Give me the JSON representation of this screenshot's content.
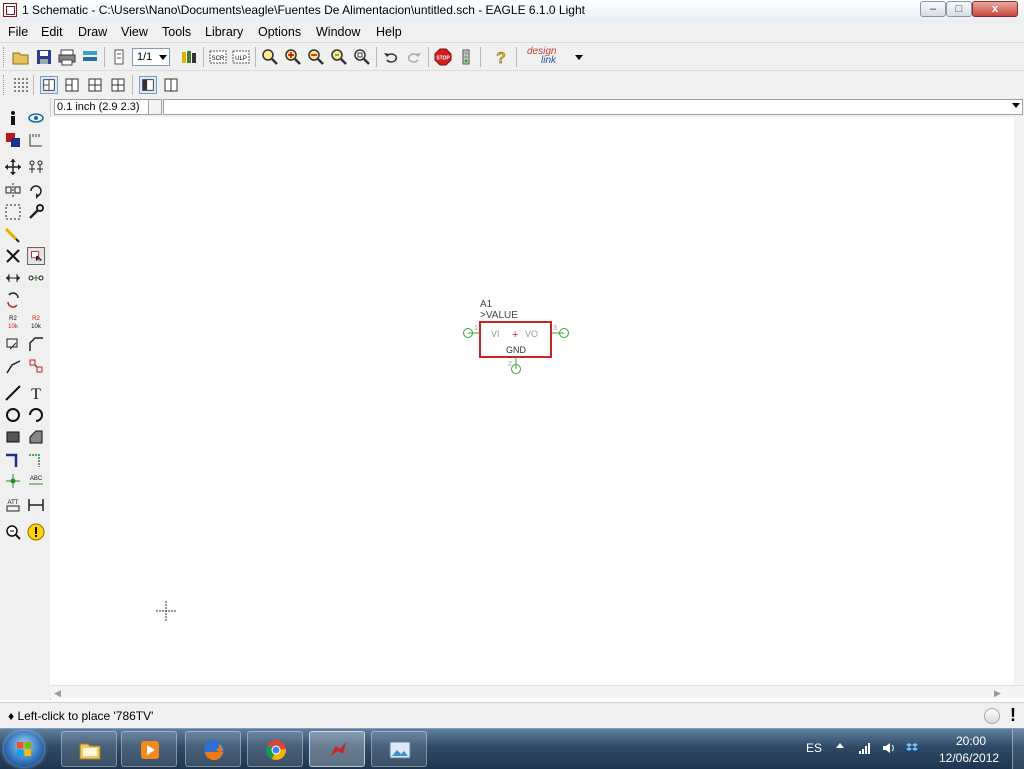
{
  "window": {
    "title": "1 Schematic - C:\\Users\\Nano\\Documents\\eagle\\Fuentes De Alimentacion\\untitled.sch - EAGLE 6.1.0 Light",
    "min_label": "–",
    "max_label": "□",
    "close_label": "x"
  },
  "menu": [
    "File",
    "Edit",
    "Draw",
    "View",
    "Tools",
    "Library",
    "Options",
    "Window",
    "Help"
  ],
  "toolbar": {
    "sheet_value": "1/1",
    "designlink_top": "design",
    "designlink_bottom": "link"
  },
  "coord": {
    "display": "0.1 inch (2.9 2.3)",
    "command_value": ""
  },
  "symbol": {
    "name": "A1",
    "value": ">VALUE",
    "pin_in": "VI",
    "pin_out": "VO",
    "pin_gnd": "GND",
    "pin1_num": "1",
    "pin2_num": "2",
    "pin3_num": "3",
    "origin_mark": "+",
    "outline_color": "#cc2222",
    "pin_color": "#33aa33",
    "pin_text_color": "#9a9a9a"
  },
  "status": {
    "text": "♦ Left-click to place '786TV'",
    "excl": "!"
  },
  "taskbar": {
    "apps": [
      "explorer-icon",
      "media-player-icon",
      "firefox-icon",
      "chrome-icon",
      "eagle-icon",
      "picture-viewer-icon"
    ],
    "active_app": "eagle-icon",
    "language": "ES",
    "time": "20:00",
    "date": "12/06/2012"
  }
}
